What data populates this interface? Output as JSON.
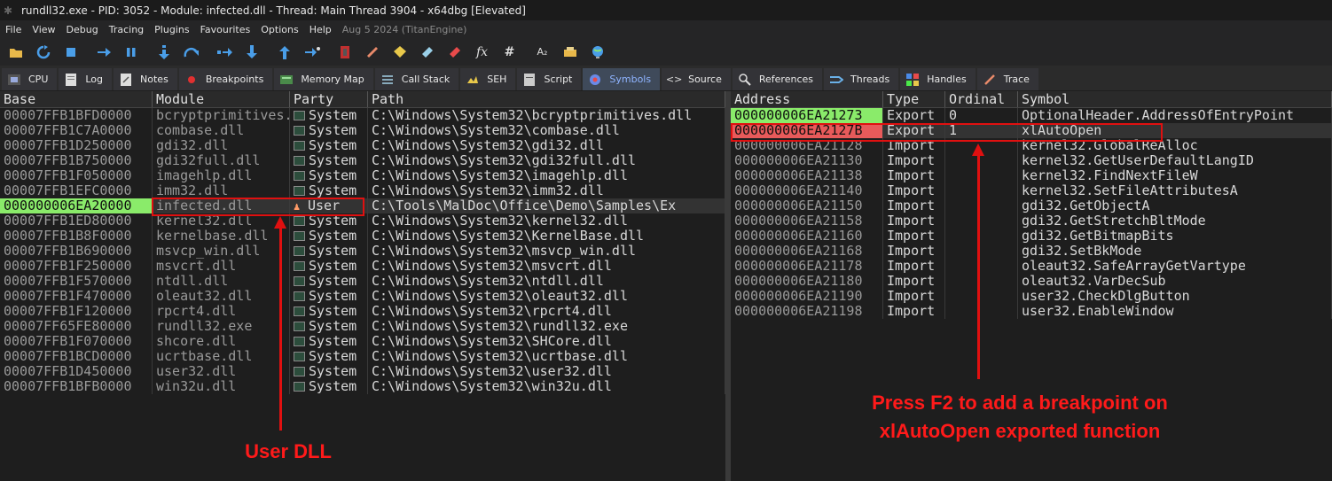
{
  "window": {
    "title": "rundll32.exe - PID: 3052 - Module: infected.dll - Thread: Main Thread 3904 - x64dbg [Elevated]"
  },
  "menu": {
    "items": [
      "File",
      "View",
      "Debug",
      "Tracing",
      "Plugins",
      "Favourites",
      "Options",
      "Help"
    ],
    "build_info": "Aug 5 2024 (TitanEngine)"
  },
  "toolbar": {
    "buttons": [
      "open-icon",
      "restart-icon",
      "stop-icon",
      "run-icon",
      "pause-icon",
      "step-into-icon",
      "step-over-icon",
      "trace-into-icon",
      "trace-over-icon",
      "execute-till-return-icon",
      "run-to-user-code-icon",
      "scylla-icon",
      "patch-icon",
      "comments-icon",
      "labels-icon",
      "bookmarks-icon",
      "functions-icon",
      "hash-icon",
      "strings-icon",
      "globe-icon"
    ],
    "labels": {
      "fx": "fx",
      "hash": "#",
      "az": "A₂"
    }
  },
  "tabs": [
    {
      "label": "CPU",
      "icon": "cpu-icon"
    },
    {
      "label": "Log",
      "icon": "log-icon"
    },
    {
      "label": "Notes",
      "icon": "notes-icon"
    },
    {
      "label": "Breakpoints",
      "icon": "breakpoint-icon"
    },
    {
      "label": "Memory Map",
      "icon": "memory-map-icon"
    },
    {
      "label": "Call Stack",
      "icon": "call-stack-icon"
    },
    {
      "label": "SEH",
      "icon": "seh-icon"
    },
    {
      "label": "Script",
      "icon": "script-icon"
    },
    {
      "label": "Symbols",
      "icon": "symbols-icon"
    },
    {
      "label": "Source",
      "icon": "source-icon"
    },
    {
      "label": "References",
      "icon": "references-icon"
    },
    {
      "label": "Threads",
      "icon": "threads-icon"
    },
    {
      "label": "Handles",
      "icon": "handles-icon"
    },
    {
      "label": "Trace",
      "icon": "trace-icon"
    }
  ],
  "modules": {
    "headers": {
      "base": "Base",
      "module": "Module",
      "party": "Party",
      "path": "Path"
    },
    "rows": [
      {
        "base": "00007FFB1BFD0000",
        "module": "bcryptprimitives.dll",
        "party": "System",
        "path": "C:\\Windows\\System32\\bcryptprimitives.dll"
      },
      {
        "base": "00007FFB1C7A0000",
        "module": "combase.dll",
        "party": "System",
        "path": "C:\\Windows\\System32\\combase.dll"
      },
      {
        "base": "00007FFB1D250000",
        "module": "gdi32.dll",
        "party": "System",
        "path": "C:\\Windows\\System32\\gdi32.dll"
      },
      {
        "base": "00007FFB1B750000",
        "module": "gdi32full.dll",
        "party": "System",
        "path": "C:\\Windows\\System32\\gdi32full.dll"
      },
      {
        "base": "00007FFB1F050000",
        "module": "imagehlp.dll",
        "party": "System",
        "path": "C:\\Windows\\System32\\imagehlp.dll"
      },
      {
        "base": "00007FFB1EFC0000",
        "module": "imm32.dll",
        "party": "System",
        "path": "C:\\Windows\\System32\\imm32.dll"
      },
      {
        "base": "000000006EA20000",
        "module": "infected.dll",
        "party": "User",
        "path": "C:\\Tools\\MalDoc\\Office\\Demo\\Samples\\Ex"
      },
      {
        "base": "00007FFB1ED80000",
        "module": "kernel32.dll",
        "party": "System",
        "path": "C:\\Windows\\System32\\kernel32.dll"
      },
      {
        "base": "00007FFB1B8F0000",
        "module": "kernelbase.dll",
        "party": "System",
        "path": "C:\\Windows\\System32\\KernelBase.dll"
      },
      {
        "base": "00007FFB1B690000",
        "module": "msvcp_win.dll",
        "party": "System",
        "path": "C:\\Windows\\System32\\msvcp_win.dll"
      },
      {
        "base": "00007FFB1F250000",
        "module": "msvcrt.dll",
        "party": "System",
        "path": "C:\\Windows\\System32\\msvcrt.dll"
      },
      {
        "base": "00007FFB1F570000",
        "module": "ntdll.dll",
        "party": "System",
        "path": "C:\\Windows\\System32\\ntdll.dll"
      },
      {
        "base": "00007FFB1F470000",
        "module": "oleaut32.dll",
        "party": "System",
        "path": "C:\\Windows\\System32\\oleaut32.dll"
      },
      {
        "base": "00007FFB1F120000",
        "module": "rpcrt4.dll",
        "party": "System",
        "path": "C:\\Windows\\System32\\rpcrt4.dll"
      },
      {
        "base": "00007FF65FE80000",
        "module": "rundll32.exe",
        "party": "System",
        "path": "C:\\Windows\\System32\\rundll32.exe"
      },
      {
        "base": "00007FFB1F070000",
        "module": "shcore.dll",
        "party": "System",
        "path": "C:\\Windows\\System32\\SHCore.dll"
      },
      {
        "base": "00007FFB1BCD0000",
        "module": "ucrtbase.dll",
        "party": "System",
        "path": "C:\\Windows\\System32\\ucrtbase.dll"
      },
      {
        "base": "00007FFB1D450000",
        "module": "user32.dll",
        "party": "System",
        "path": "C:\\Windows\\System32\\user32.dll"
      },
      {
        "base": "00007FFB1BFB0000",
        "module": "win32u.dll",
        "party": "System",
        "path": "C:\\Windows\\System32\\win32u.dll"
      }
    ]
  },
  "symbols": {
    "headers": {
      "address": "Address",
      "type": "Type",
      "ordinal": "Ordinal",
      "symbol": "Symbol"
    },
    "rows": [
      {
        "address": "000000006EA21273",
        "type": "Export",
        "ordinal": "0",
        "symbol": "OptionalHeader.AddressOfEntryPoint"
      },
      {
        "address": "000000006EA2127B",
        "type": "Export",
        "ordinal": "1",
        "symbol": "xlAutoOpen"
      },
      {
        "address": "000000006EA21128",
        "type": "Import",
        "ordinal": "",
        "symbol": "kernel32.GlobalReAlloc"
      },
      {
        "address": "000000006EA21130",
        "type": "Import",
        "ordinal": "",
        "symbol": "kernel32.GetUserDefaultLangID"
      },
      {
        "address": "000000006EA21138",
        "type": "Import",
        "ordinal": "",
        "symbol": "kernel32.FindNextFileW"
      },
      {
        "address": "000000006EA21140",
        "type": "Import",
        "ordinal": "",
        "symbol": "kernel32.SetFileAttributesA"
      },
      {
        "address": "000000006EA21150",
        "type": "Import",
        "ordinal": "",
        "symbol": "gdi32.GetObjectA"
      },
      {
        "address": "000000006EA21158",
        "type": "Import",
        "ordinal": "",
        "symbol": "gdi32.GetStretchBltMode"
      },
      {
        "address": "000000006EA21160",
        "type": "Import",
        "ordinal": "",
        "symbol": "gdi32.GetBitmapBits"
      },
      {
        "address": "000000006EA21168",
        "type": "Import",
        "ordinal": "",
        "symbol": "gdi32.SetBkMode"
      },
      {
        "address": "000000006EA21178",
        "type": "Import",
        "ordinal": "",
        "symbol": "oleaut32.SafeArrayGetVartype"
      },
      {
        "address": "000000006EA21180",
        "type": "Import",
        "ordinal": "",
        "symbol": "oleaut32.VarDecSub"
      },
      {
        "address": "000000006EA21190",
        "type": "Import",
        "ordinal": "",
        "symbol": "user32.CheckDlgButton"
      },
      {
        "address": "000000006EA21198",
        "type": "Import",
        "ordinal": "",
        "symbol": "user32.EnableWindow"
      }
    ]
  },
  "annotations": {
    "user_dll": "User DLL",
    "breakpoint_hint_line1": "Press F2 to add a breakpoint on",
    "breakpoint_hint_line2": "xlAutoOpen exported function"
  },
  "colors": {
    "highlight_green": "#8aeb6a",
    "highlight_red": "#e85a5a",
    "annotation_red": "#ff1a1a",
    "active_tab_text": "#8fb4ff"
  }
}
